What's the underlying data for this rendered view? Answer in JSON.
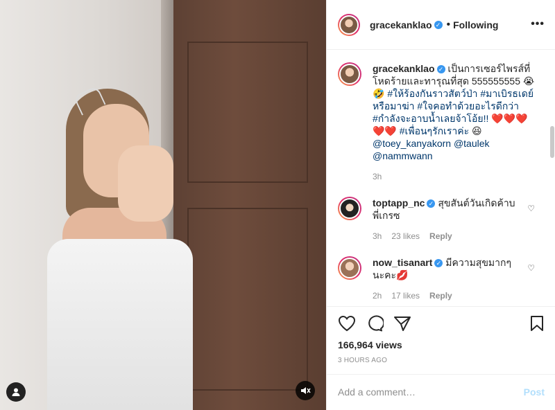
{
  "post": {
    "username": "gracekanklao",
    "follow_status": "Following",
    "more_icon": "•••"
  },
  "caption": {
    "username": "gracekanklao",
    "text_main": "เป็นการเซอร์ไพรส์ที่โหดร้ายและทารุณที่สุด 555555555 😭🤣 ",
    "hashtags": "#ให้ร้องกันราวสัตว์ป่า #มาเบิรธเดย์หรือมาฆ่า #ใจคอทำด้วยอะไรดีกว่า #กำลังจะอาบน้ำเลยจ้าโอ้ย!!",
    "emoji_tail": " ❤️❤️❤️❤️❤️ ",
    "hashtag2": "#เพื่อนๆรักเราค่ะ",
    "emoji_end": " 😆",
    "mentions": "@toey_kanyakorn @taulek @nammwann",
    "time": "3h"
  },
  "comments": [
    {
      "username": "toptapp_nc",
      "text": "สุขสันต์วันเกิดค้าบพี่เกรซ",
      "time": "3h",
      "likes": "23 likes",
      "reply": "Reply"
    },
    {
      "username": "now_tisanart",
      "text": "มีความสุขมากๆนะคะ💋",
      "time": "2h",
      "likes": "17 likes",
      "reply": "Reply"
    }
  ],
  "stats": {
    "views": "166,964 views",
    "posted": "3 HOURS AGO"
  },
  "add_comment": {
    "placeholder": "Add a comment…",
    "post_label": "Post"
  },
  "icons": {
    "like": "heart-outline-icon",
    "comment": "comment-bubble-icon",
    "share": "paper-plane-icon",
    "save": "bookmark-icon",
    "mute": "speaker-muted-icon",
    "tags": "user-tag-icon"
  }
}
